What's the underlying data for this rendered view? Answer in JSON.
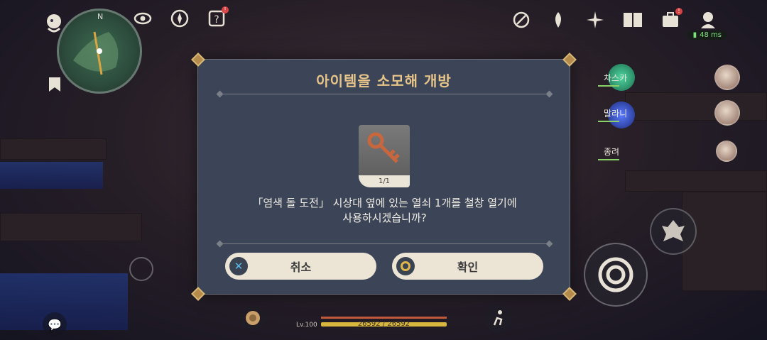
{
  "dialog": {
    "title": "아이템을 소모해 개방",
    "item_quantity": "1/1",
    "message_line1": "「염색 돌 도전」 시상대 옆에 있는 열쇠 1개를 철창 열기에",
    "message_line2": "사용하시겠습니까?",
    "cancel_label": "취소",
    "confirm_label": "확인"
  },
  "hud": {
    "minimap_north": "N",
    "ping": "48 ms",
    "party": [
      {
        "name": "차스카"
      },
      {
        "name": "말라니"
      },
      {
        "name": "종려"
      }
    ],
    "level": "Lv.100",
    "hp": "26592 / 26592"
  },
  "icons": {
    "top_left": [
      "paimon-menu-icon",
      "eye-icon",
      "compass-icon",
      "quest-icon"
    ],
    "top_right": [
      "event-compass-icon",
      "wish-icon",
      "sparkle-icon",
      "book-icon",
      "inventory-icon",
      "character-icon"
    ]
  },
  "colors": {
    "title_gold": "#e7c58a",
    "dialog_bg": "#3c4558",
    "button_bg": "#ece5d6",
    "hp_bar": "#d9b73e",
    "cancel_icon": "#59b8e8",
    "confirm_icon": "#e2b84a"
  }
}
